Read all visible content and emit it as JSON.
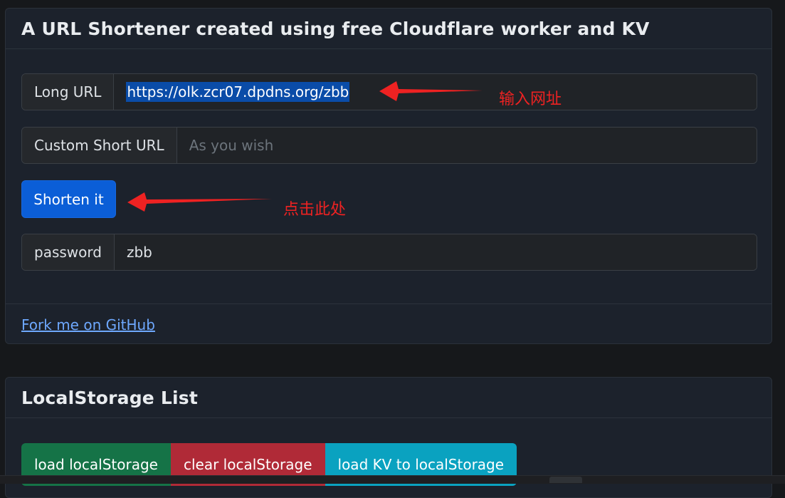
{
  "shortener": {
    "title": "A URL Shortener created using free Cloudflare worker and KV",
    "long_url": {
      "label": "Long URL",
      "value": "https://olk.zcr07.dpdns.org/zbb"
    },
    "custom_short_url": {
      "label": "Custom Short URL",
      "placeholder": "As you wish"
    },
    "shorten_button": "Shorten it",
    "password": {
      "label": "password",
      "value": "zbb"
    },
    "footer_link": "Fork me on GitHub"
  },
  "annotations": {
    "input_hint": "输入网址",
    "click_hint": "点击此处",
    "color": "#ee2222"
  },
  "local_storage": {
    "title": "LocalStorage List",
    "buttons": {
      "load": "load localStorage",
      "clear": "clear localStorage",
      "load_kv": "load KV to localStorage"
    }
  },
  "colors": {
    "primary": "#0b5ed7",
    "success": "#157347",
    "danger": "#b02a37",
    "info": "#0aa2c0",
    "link": "#6ea8fe"
  }
}
